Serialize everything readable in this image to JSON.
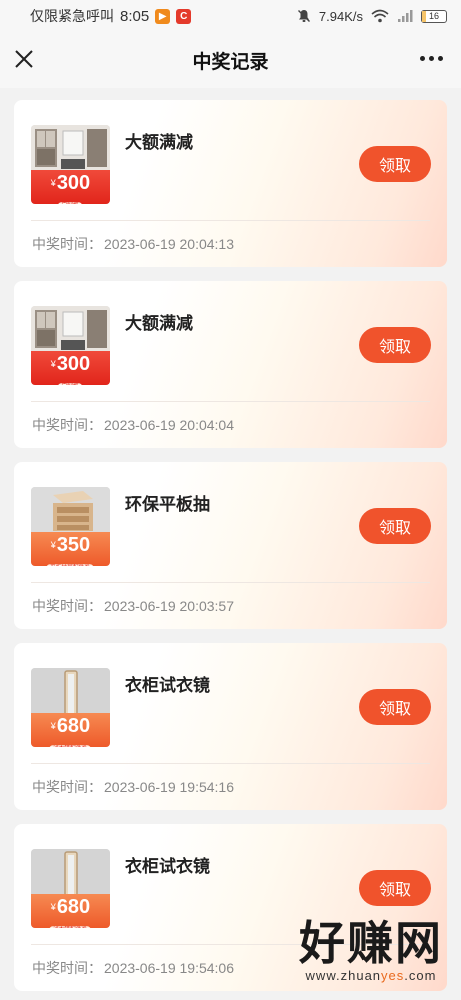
{
  "status_bar": {
    "carrier_text": "仅限紧急呼叫",
    "time": "8:05",
    "network_speed": "7.94K/s",
    "battery": "16",
    "battery_level": 0.16
  },
  "nav": {
    "title": "中奖记录"
  },
  "records": [
    {
      "name": "大额满减",
      "coupon_value": "300",
      "coupon_tag": "定制柜",
      "button": "领取",
      "time_label": "中奖时间：",
      "time": "2023-06-19 20:04:13",
      "thumb": "cabinet-room"
    },
    {
      "name": "大额满减",
      "coupon_value": "300",
      "coupon_tag": "定制柜",
      "button": "领取",
      "time_label": "中奖时间：",
      "time": "2023-06-19 20:04:04",
      "thumb": "cabinet-room"
    },
    {
      "name": "环保平板抽",
      "coupon_value": "350",
      "coupon_tag": "平板抽屉配件券",
      "button": "领取",
      "time_label": "中奖时间：",
      "time": "2023-06-19 20:03:57",
      "thumb": "drawer"
    },
    {
      "name": "衣柜试衣镜",
      "coupon_value": "680",
      "coupon_tag": "试衣镜配件券",
      "button": "领取",
      "time_label": "中奖时间：",
      "time": "2023-06-19 19:54:16",
      "thumb": "mirror"
    },
    {
      "name": "衣柜试衣镜",
      "coupon_value": "680",
      "coupon_tag": "试衣镜配件券",
      "button": "领取",
      "time_label": "中奖时间：",
      "time": "2023-06-19 19:54:06",
      "thumb": "mirror"
    }
  ],
  "currency_symbol": "¥",
  "watermark": {
    "logo": "好赚网",
    "url_pre": "www.zhuan",
    "url_accent": "yes",
    "url_post": ".com"
  },
  "colors": {
    "accent": "#f0532c",
    "coupon_red": "#e1251b",
    "coupon_orange": "#ee5a2a"
  }
}
